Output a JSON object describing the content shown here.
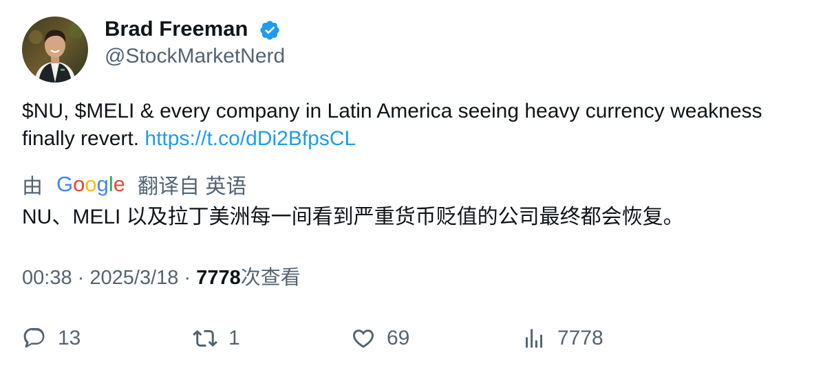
{
  "author": {
    "name": "Brad Freeman",
    "handle": "@StockMarketNerd",
    "verified_color": "#1d9bf0"
  },
  "tweet": {
    "text": "$NU, $MELI & every company in Latin America seeing heavy currency weakness finally revert.",
    "link": "https://t.co/dDi2BfpsCL"
  },
  "translation": {
    "by_label": "由",
    "provider": "Google",
    "from_label": "翻译自 英语",
    "text": "NU、MELI 以及拉丁美洲每一间看到严重货币贬值的公司最终都会恢复。"
  },
  "meta": {
    "time": "00:38",
    "separator": "·",
    "date": "2025/3/18",
    "views": "7778",
    "views_label": "次查看"
  },
  "actions": {
    "reply": {
      "icon": "reply-icon",
      "count": "13"
    },
    "retweet": {
      "icon": "retweet-icon",
      "count": "1"
    },
    "like": {
      "icon": "heart-icon",
      "count": "69"
    },
    "views": {
      "icon": "analytics-icon",
      "count": "7778"
    }
  },
  "colors": {
    "text": "#0f1419",
    "secondary": "#536471",
    "link": "#1d9bf0"
  }
}
